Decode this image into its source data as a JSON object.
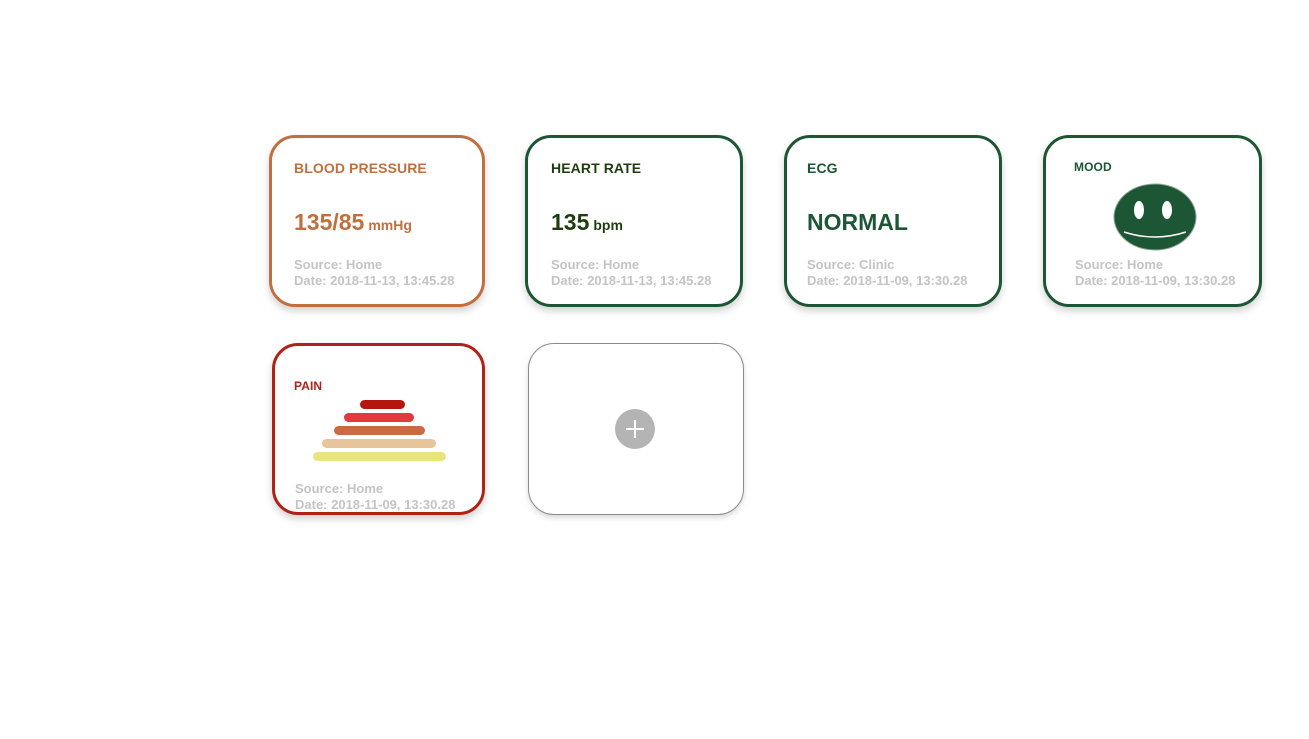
{
  "colors": {
    "blood_pressure": "#c0703e",
    "heart_rate": "#1d5634",
    "heart_rate_title": "#1f3d10",
    "ecg": "#1d5634",
    "mood": "#1d5634",
    "pain": "#b02116",
    "meta_text": "#c4c4c4"
  },
  "cards": {
    "blood_pressure": {
      "title": "BLOOD PRESSURE",
      "value": "135/85",
      "unit": "mmHg",
      "source": "Source: Home",
      "date": "Date: 2018-11-13, 13:45.28"
    },
    "heart_rate": {
      "title": "HEART RATE",
      "value": "135",
      "unit": "bpm",
      "source": "Source: Home",
      "date": "Date: 2018-11-13, 13:45.28"
    },
    "ecg": {
      "title": "ECG",
      "value": "NORMAL",
      "source": "Source: Clinic",
      "date": "Date: 2018-11-09, 13:30.28"
    },
    "mood": {
      "title": "MOOD",
      "icon": "smiley-face-icon",
      "source": "Source: Home",
      "date": "Date: 2018-11-09, 13:30.28"
    },
    "pain": {
      "title": "PAIN",
      "icon": "pain-scale-pyramid-icon",
      "scale_colors": [
        "#b4150f",
        "#e0393f",
        "#c96a45",
        "#e8c49b",
        "#e8e57c"
      ],
      "source": "Source: Home",
      "date": "Date: 2018-11-09, 13:30.28"
    },
    "add": {
      "icon": "plus-icon"
    }
  }
}
